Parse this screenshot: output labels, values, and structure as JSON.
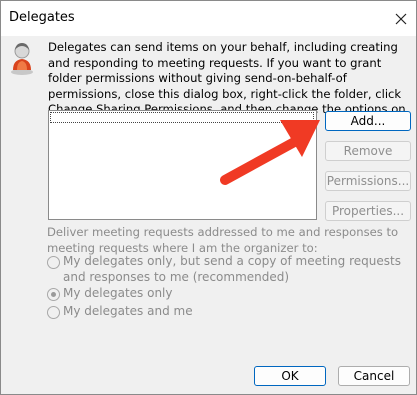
{
  "window": {
    "title": "Delegates",
    "close_icon": "close-icon"
  },
  "description": "Delegates can send items on your behalf, including creating and responding to meeting requests. If you want to grant folder permissions without giving send-on-behalf-of permissions, close this dialog box, right-click the folder, click Change Sharing Permissions, and then change the options on the Permissions tab.",
  "delegates_list": {
    "items": []
  },
  "buttons": {
    "add": "Add...",
    "remove": "Remove",
    "permissions": "Permissions...",
    "properties": "Properties...",
    "ok": "OK",
    "cancel": "Cancel"
  },
  "meeting_requests": {
    "label": "Deliver meeting requests addressed to me and responses to meeting requests where I am the organizer to:",
    "options": [
      {
        "label": "My delegates only, but send a copy of meeting requests and responses to me (recommended)",
        "selected": false
      },
      {
        "label": "My delegates only",
        "selected": true
      },
      {
        "label": "My delegates and me",
        "selected": false
      }
    ]
  },
  "annotation": {
    "arrow_color": "#f03a24"
  }
}
